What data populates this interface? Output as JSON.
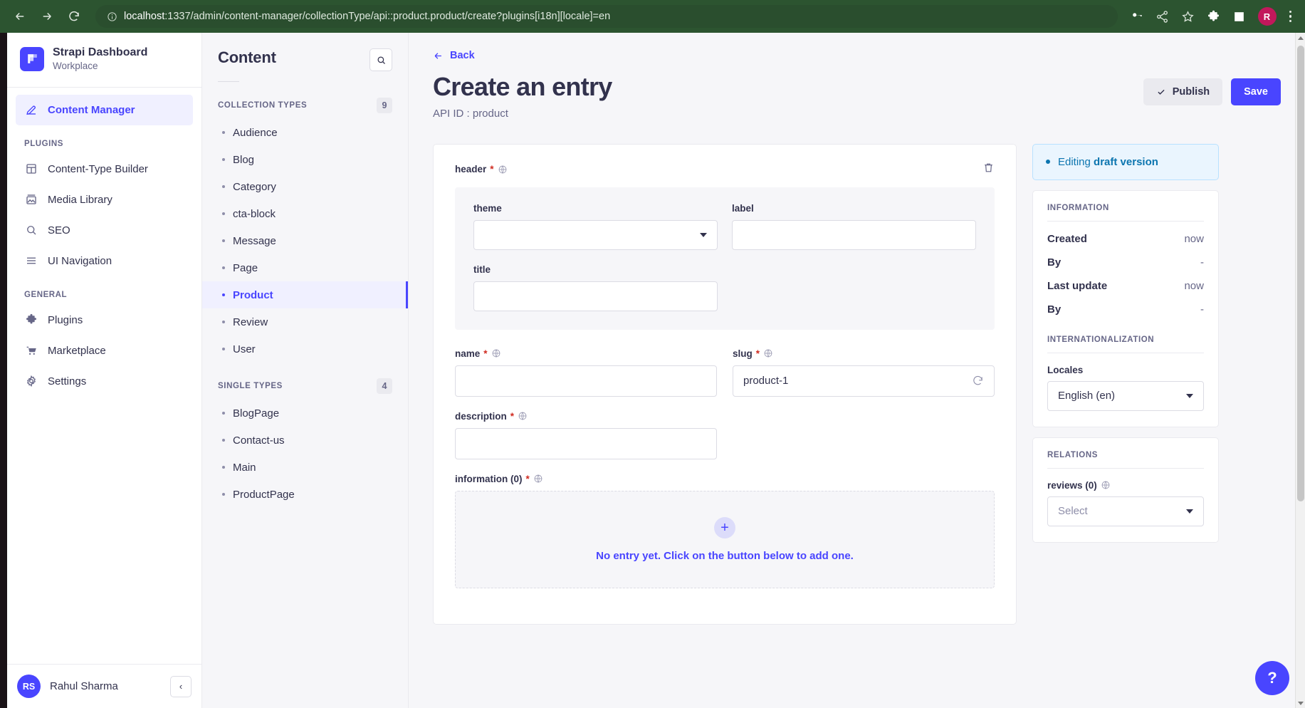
{
  "browser": {
    "back_icon": "back-arrow-icon",
    "forward_icon": "forward-arrow-icon",
    "reload_icon": "reload-icon",
    "site_info_icon": "site-info-icon",
    "url_host": "localhost",
    "url_rest": ":1337/admin/content-manager/collectionType/api::product.product/create?plugins[i18n][locale]=en",
    "toolbar_icons": [
      "key-icon",
      "share-icon",
      "star-icon",
      "extensions-puzzle-icon",
      "side-panel-icon"
    ],
    "profile_initial": "R",
    "menu_icon": "kebab-menu-icon"
  },
  "sidebar": {
    "brand": {
      "title": "Strapi Dashboard",
      "subtitle": "Workplace",
      "logo_icon": "strapi-logo-icon"
    },
    "primary": [
      {
        "label": "Content Manager",
        "icon": "pen-edit-icon",
        "active": true
      }
    ],
    "sections": [
      {
        "label": "PLUGINS",
        "items": [
          {
            "label": "Content-Type Builder",
            "icon": "layout-blocks-icon"
          },
          {
            "label": "Media Library",
            "icon": "image-picture-icon"
          },
          {
            "label": "SEO",
            "icon": "search-icon"
          },
          {
            "label": "UI Navigation",
            "icon": "hamburger-lines-icon"
          }
        ]
      },
      {
        "label": "GENERAL",
        "items": [
          {
            "label": "Plugins",
            "icon": "puzzle-piece-icon"
          },
          {
            "label": "Marketplace",
            "icon": "shopping-cart-icon"
          },
          {
            "label": "Settings",
            "icon": "gear-icon"
          }
        ]
      }
    ],
    "footer": {
      "initials": "RS",
      "username": "Rahul Sharma",
      "collapse_icon": "chevron-left-icon"
    }
  },
  "content_nav": {
    "title": "Content",
    "search_icon": "search-icon",
    "groups": [
      {
        "label": "COLLECTION TYPES",
        "count": "9",
        "items": [
          {
            "label": "Audience",
            "active": false
          },
          {
            "label": "Blog",
            "active": false
          },
          {
            "label": "Category",
            "active": false
          },
          {
            "label": "cta-block",
            "active": false
          },
          {
            "label": "Message",
            "active": false
          },
          {
            "label": "Page",
            "active": false
          },
          {
            "label": "Product",
            "active": true
          },
          {
            "label": "Review",
            "active": false
          },
          {
            "label": "User",
            "active": false
          }
        ]
      },
      {
        "label": "SINGLE TYPES",
        "count": "4",
        "items": [
          {
            "label": "BlogPage",
            "active": false
          },
          {
            "label": "Contact-us",
            "active": false
          },
          {
            "label": "Main",
            "active": false
          },
          {
            "label": "ProductPage",
            "active": false
          }
        ]
      }
    ]
  },
  "main": {
    "back_label": "Back",
    "back_icon": "arrow-left-icon",
    "title": "Create an entry",
    "subtitle": "API ID : product",
    "publish_label": "Publish",
    "publish_icon": "check-icon",
    "save_label": "Save",
    "component": {
      "label": "header",
      "required_mark": "*",
      "locale_icon": "globe-icon",
      "delete_icon": "trash-icon",
      "fields": [
        {
          "label": "theme",
          "type": "select",
          "value": "",
          "placeholder": ""
        },
        {
          "label": "label",
          "type": "text",
          "value": "",
          "placeholder": ""
        },
        {
          "label": "title",
          "type": "text",
          "value": "",
          "placeholder": ""
        }
      ]
    },
    "fields": {
      "name": {
        "label": "name",
        "required_mark": "*",
        "value": "",
        "placeholder": ""
      },
      "slug": {
        "label": "slug",
        "required_mark": "*",
        "value": "product-1",
        "placeholder": "",
        "regenerate_icon": "refresh-icon"
      },
      "description": {
        "label": "description",
        "required_mark": "*",
        "value": "",
        "placeholder": ""
      },
      "information": {
        "label": "information (0)",
        "required_mark": "*"
      }
    },
    "repeatable_empty": {
      "add_icon": "plus-icon",
      "text": "No entry yet. Click on the button below to add one."
    }
  },
  "right_rail": {
    "draft": {
      "prefix": "Editing ",
      "strong": "draft version"
    },
    "information": {
      "title": "INFORMATION",
      "rows": [
        {
          "key": "Created",
          "value": "now"
        },
        {
          "key": "By",
          "value": "-"
        },
        {
          "key": "Last update",
          "value": "now"
        },
        {
          "key": "By",
          "value": "-"
        }
      ]
    },
    "i18n": {
      "title": "INTERNATIONALIZATION",
      "locales_label": "Locales",
      "locale_value": "English (en)"
    },
    "relations": {
      "title": "RELATIONS",
      "field_label": "reviews (0)",
      "locale_icon": "globe-icon",
      "select_placeholder": "Select"
    }
  },
  "help": {
    "label": "?"
  },
  "colors": {
    "brand_primary": "#4945ff",
    "browser_chrome": "#2c5430",
    "required": "#d02b20",
    "draft_blue": "#0c75af",
    "text_primary": "#32324d",
    "text_muted": "#666687"
  }
}
